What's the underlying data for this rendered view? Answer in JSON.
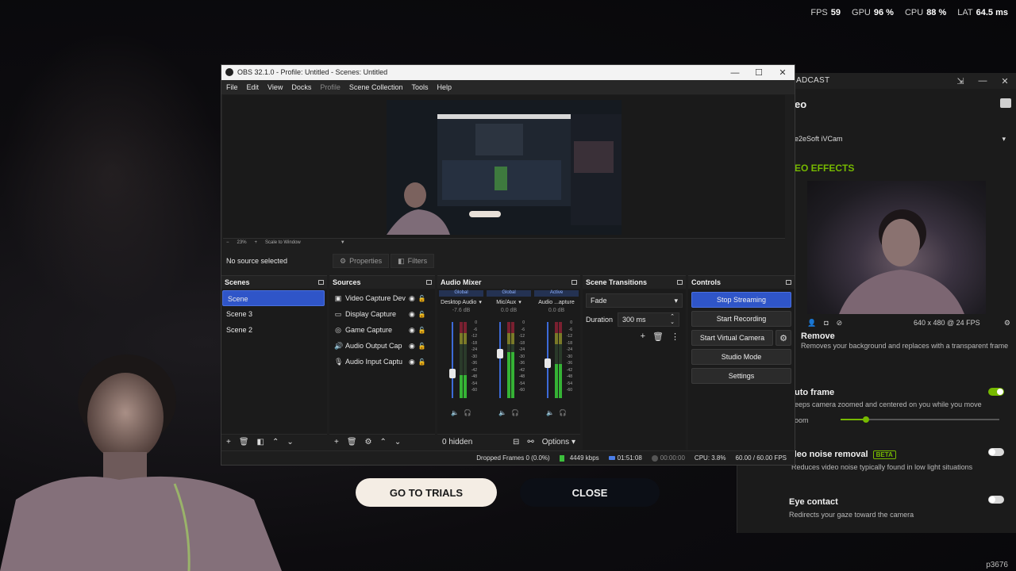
{
  "overlay": {
    "fps_label": "FPS",
    "fps_value": "59",
    "gpu_label": "GPU",
    "gpu_value": "96 %",
    "cpu_label": "CPU",
    "cpu_value": "88 %",
    "lat_label": "LAT",
    "lat_value": "64.5 ms",
    "watermark": "p3676"
  },
  "dialog": {
    "go_to_trials": "GO TO TRIALS",
    "close": "CLOSE"
  },
  "broadcast": {
    "title": "ADCAST",
    "section": "eo",
    "device": "e2eSoft iVCam",
    "effects_heading": "EO EFFECTS",
    "resolution": "640 x 480 @ 24 FPS",
    "items": [
      {
        "title": "Remove",
        "desc": "Removes your background and replaces with a transparent frame",
        "on": false
      },
      {
        "title": "uto frame",
        "desc": "eeps camera zoomed and centered on you while you move",
        "on": true,
        "slider_label": "oom",
        "zoom_level": 0.16
      },
      {
        "title": "deo noise removal",
        "badge": "BETA",
        "desc": "Reduces video noise typically found in low light situations",
        "on": false
      },
      {
        "title": "Eye contact",
        "desc": "Redirects your gaze toward the camera",
        "on": false
      }
    ]
  },
  "obs": {
    "title": "OBS 32.1.0 - Profile: Untitled - Scenes: Untitled",
    "menu": [
      "File",
      "Edit",
      "View",
      "Docks",
      "Profile",
      "Scene Collection",
      "Tools",
      "Help"
    ],
    "zoom": "23%",
    "scale_label": "Scale to Window",
    "no_source": "No source selected",
    "properties": "Properties",
    "filters": "Filters",
    "scenes_head": "Scenes",
    "scenes": [
      "Scene",
      "Scene 3",
      "Scene 2"
    ],
    "sources_head": "Sources",
    "sources": [
      {
        "name": "Video Capture Dev",
        "icon": "camera-icon"
      },
      {
        "name": "Display Capture",
        "icon": "monitor-icon"
      },
      {
        "name": "Game Capture",
        "icon": "gamepad-icon"
      },
      {
        "name": "Audio Output Cap",
        "icon": "speaker-icon"
      },
      {
        "name": "Audio Input Captu",
        "icon": "mic-icon"
      }
    ],
    "mixer_head": "Audio Mixer",
    "channels": [
      {
        "tag": "Global",
        "name": "Desktop Audio",
        "db": "-7.6 dB",
        "level": 0.3
      },
      {
        "tag": "Global",
        "name": "Mic/Aux",
        "db": "0.0 dB",
        "level": 0.6
      },
      {
        "tag": "Active",
        "name": "Audio ...apture",
        "db": "0.0 dB",
        "level": 0.45
      }
    ],
    "db_scale": [
      "0",
      "-6",
      "-12",
      "-18",
      "-24",
      "-30",
      "-36",
      "-42",
      "-48",
      "-54",
      "-60"
    ],
    "hidden": "0 hidden",
    "options": "Options",
    "transitions_head": "Scene Transitions",
    "transition": "Fade",
    "duration_label": "Duration",
    "duration": "300 ms",
    "controls_head": "Controls",
    "controls": {
      "stop_streaming": "Stop Streaming",
      "start_recording": "Start Recording",
      "start_virtual_camera": "Start Virtual Camera",
      "studio_mode": "Studio Mode",
      "settings": "Settings"
    },
    "status": {
      "dropped": "Dropped Frames 0 (0.0%)",
      "kbps": "4449 kbps",
      "stream_time": "01:51:08",
      "rec_time": "00:00:00",
      "cpu": "CPU: 3.8%",
      "fps": "60.00 / 60.00 FPS"
    }
  }
}
